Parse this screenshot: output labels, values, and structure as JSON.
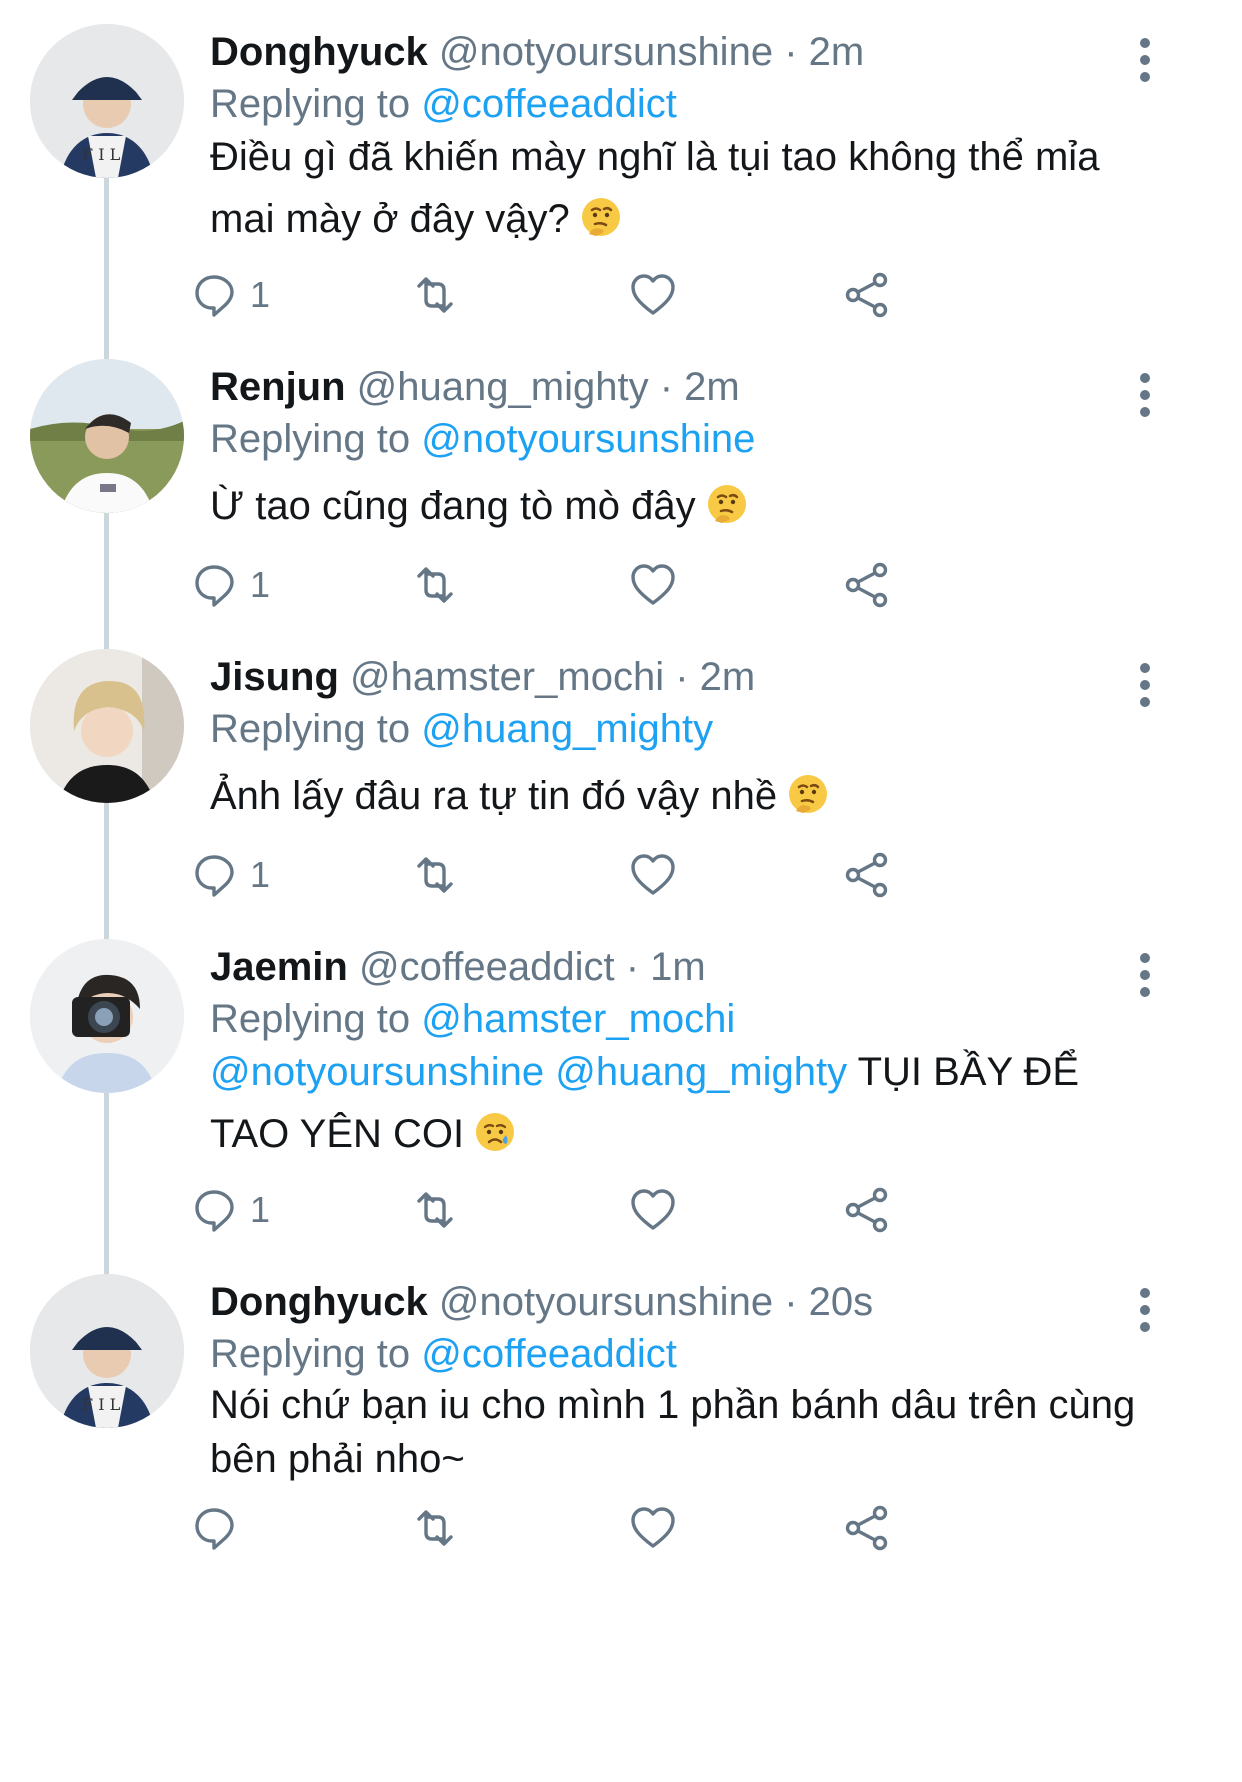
{
  "colors": {
    "link": "#1da1f2",
    "muted": "#657786",
    "text": "#14171a",
    "thread": "#ccd6dd"
  },
  "tweets": [
    {
      "name": "Donghyuck",
      "handle": "@notyoursunshine",
      "time": "· 2m",
      "replying_label": "Replying to",
      "replying_to": "@coffeeaddict",
      "text": "Điều gì đã khiến mày nghĩ là tụi tao không thể mỉa mai mày ở đây vậy?",
      "emoji": "thinking-face",
      "reply_count": "1"
    },
    {
      "name": "Renjun",
      "handle": "@huang_mighty",
      "time": "· 2m",
      "replying_label": "Replying to",
      "replying_to": "@notyoursunshine",
      "text": "Ừ tao cũng đang tò mò đây",
      "emoji": "thinking-face",
      "reply_count": "1"
    },
    {
      "name": "Jisung",
      "handle": "@hamster_mochi",
      "time": "· 2m",
      "replying_label": "Replying to",
      "replying_to": "@huang_mighty",
      "text": "Ảnh lấy đâu ra tự tin đó vậy nhề",
      "emoji": "thinking-face",
      "reply_count": "1"
    },
    {
      "name": "Jaemin",
      "handle": "@coffeeaddict",
      "time": "· 1m",
      "replying_label": "Replying to",
      "replying_to": "@hamster_mochi",
      "mention_1": "@notyoursunshine",
      "mention_2": "@huang_mighty",
      "text": "TỤI BẦY ĐỂ TAO YÊN COI",
      "emoji": "crying-face",
      "reply_count": "1"
    },
    {
      "name": "Donghyuck",
      "handle": "@notyoursunshine",
      "time": "· 20s",
      "replying_label": "Replying to",
      "replying_to": "@coffeeaddict",
      "text": "Nói chứ bạn iu cho mình 1 phần bánh dâu trên cùng bên phải nho~",
      "reply_count": ""
    }
  ]
}
